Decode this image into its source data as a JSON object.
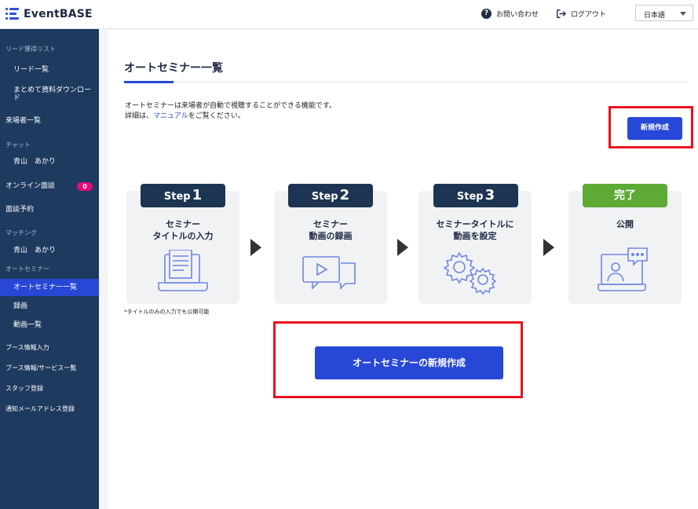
{
  "app": {
    "name": "EventBASE"
  },
  "header": {
    "help": "お問い合わせ",
    "logout": "ログアウト",
    "language": "日本語"
  },
  "sidebar": {
    "lead_section": "リード獲得リスト",
    "lead_list": "リード一覧",
    "bulk_download": "まとめて資料ダウンロード",
    "visitors": "来場者一覧",
    "chat_section": "チャット",
    "chat_user": "青山　あかり",
    "online_meeting": "オンライン面談",
    "online_meeting_badge": "0",
    "meeting_reservation": "面談予約",
    "matching_section": "マッチング",
    "matching_user": "青山　あかり",
    "auto_seminar_section": "オートセミナー",
    "auto_seminar_list": "オートセミナー一覧",
    "recording": "録画",
    "video_list": "動画一覧",
    "booth_info": "ブース情報入力",
    "booth_services": "ブース情報/サービス一覧",
    "staff": "スタッフ登録",
    "notify_email": "通知メールアドレス登録"
  },
  "main": {
    "title": "オートセミナー一覧",
    "desc_line1": "オートセミナーは来場者が自動で視聴することができる機能です。",
    "desc_prefix": "詳細は、",
    "desc_link": "マニュアル",
    "desc_suffix": "をご覧ください。",
    "new_button": "新規作成",
    "create_button": "オートセミナーの新規作成",
    "note": "*タイトルのみの入力でも公開可能"
  },
  "steps": [
    {
      "word": "Step",
      "num": "1",
      "line1": "セミナー",
      "line2": "タイトルの入力"
    },
    {
      "word": "Step",
      "num": "2",
      "line1": "セミナー",
      "line2": "動画の録画"
    },
    {
      "word": "Step",
      "num": "3",
      "line1": "セミナータイトルに",
      "line2": "動画を設定"
    },
    {
      "done": "完了",
      "line1": "公開"
    }
  ],
  "colors": {
    "accent": "#2747d6",
    "sidebar": "#1f3a5f",
    "highlight": "#e8101f",
    "done": "#5daa34"
  }
}
